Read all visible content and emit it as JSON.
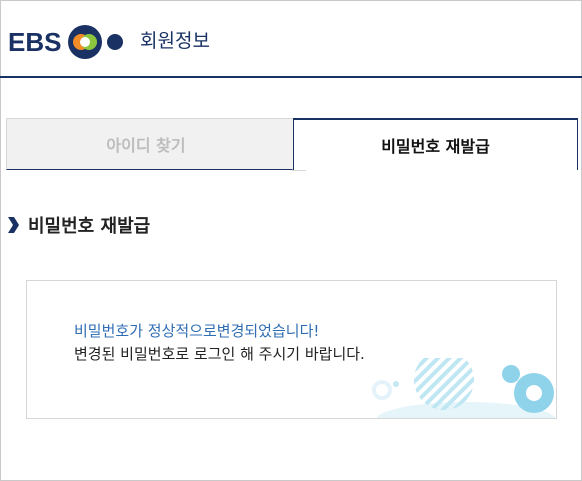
{
  "header": {
    "logo_text": "EBS",
    "title": "회원정보",
    "colors": {
      "brand": "#1a3263",
      "logo_orange": "#f28c28",
      "logo_green": "#8cc63f"
    }
  },
  "tabs": [
    {
      "label": "아이디 찾기",
      "active": false
    },
    {
      "label": "비밀번호 재발급",
      "active": true
    }
  ],
  "section": {
    "heading": "비밀번호 재발급",
    "icon": "chevron-right-icon"
  },
  "message": {
    "line1": "비밀번호가 정상적으로변경되었습니다!",
    "line2": "변경된 비밀번호로 로그인 해 주시기 바랍니다.",
    "colors": {
      "highlight": "#2f6db3",
      "decor": "#8fd3ea"
    }
  }
}
